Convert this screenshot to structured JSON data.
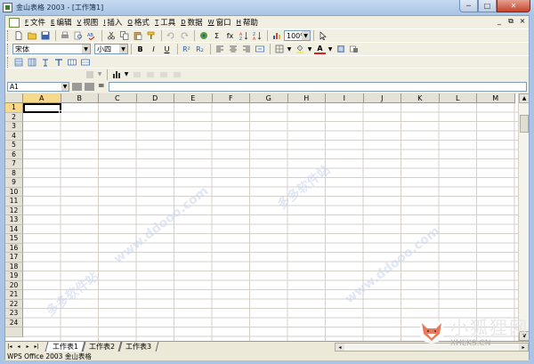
{
  "window": {
    "title": "金山表格 2003 - [工作簿1]",
    "controls": {
      "minimize": "─",
      "maximize": "□",
      "close": "✕"
    }
  },
  "menubar": {
    "items": [
      {
        "key": "F",
        "label": "文件"
      },
      {
        "key": "E",
        "label": "编辑"
      },
      {
        "key": "V",
        "label": "视图"
      },
      {
        "key": "I",
        "label": "插入"
      },
      {
        "key": "O",
        "label": "格式"
      },
      {
        "key": "T",
        "label": "工具"
      },
      {
        "key": "D",
        "label": "数据"
      },
      {
        "key": "W",
        "label": "窗口"
      },
      {
        "key": "H",
        "label": "帮助"
      }
    ],
    "mdi_controls": [
      "_",
      "⧉",
      "×"
    ]
  },
  "standard_toolbar": {
    "zoom": "100%",
    "sigma": "Σ",
    "fx": "fx"
  },
  "format_toolbar": {
    "font_name": "宋体",
    "font_size": "小四",
    "bold": "B",
    "italic": "I",
    "underline": "U",
    "superscript": "R²",
    "subscript": "R₂",
    "font_color_label": "A"
  },
  "formula_bar": {
    "cell_ref": "A1",
    "equals": "=",
    "formula": ""
  },
  "grid": {
    "columns": [
      "A",
      "B",
      "C",
      "D",
      "E",
      "F",
      "G",
      "H",
      "I",
      "J",
      "K",
      "L",
      "M"
    ],
    "rows": [
      "1",
      "2",
      "3",
      "4",
      "5",
      "6",
      "7",
      "8",
      "9",
      "10",
      "11",
      "12",
      "13",
      "14",
      "15",
      "16",
      "17",
      "18",
      "19",
      "20",
      "21",
      "22",
      "23",
      "24"
    ],
    "active_column": "A",
    "active_row": "1"
  },
  "sheet_tabs": {
    "nav": [
      "|◂",
      "◂",
      "▸",
      "▸|"
    ],
    "tabs": [
      "工作表1",
      "工作表2",
      "工作表3"
    ],
    "active": "工作表1"
  },
  "statusbar": {
    "text": "WPS Office 2003 金山表格"
  },
  "watermarks": {
    "site_url": "www.ddooo.com",
    "site_name": "多多软件站",
    "brand_cn": "小狐狸网",
    "brand_url": "XHLKS.CN"
  }
}
